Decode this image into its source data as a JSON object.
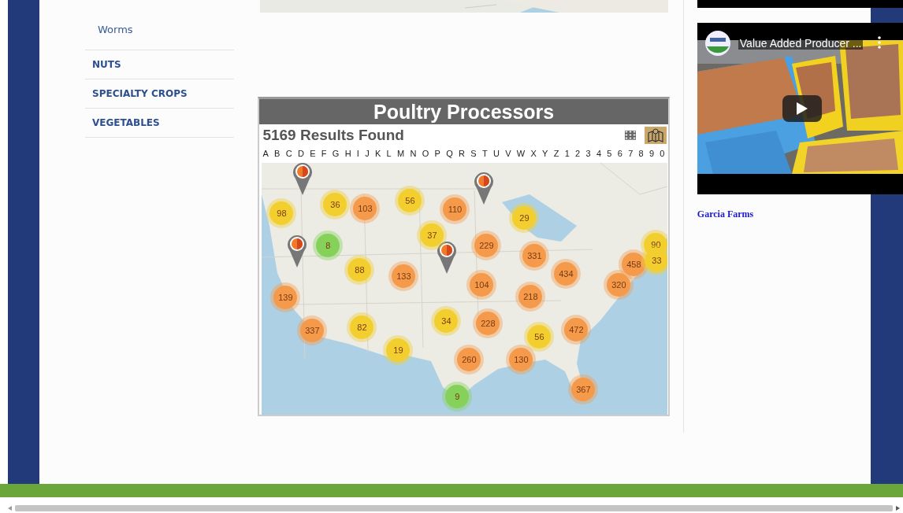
{
  "sidebar": {
    "items": [
      {
        "label": "Worms",
        "kind": "sub"
      },
      {
        "label": "NUTS",
        "kind": "category"
      },
      {
        "label": "SPECIALTY CROPS",
        "kind": "category"
      },
      {
        "label": "VEGETABLES",
        "kind": "category"
      }
    ]
  },
  "directory": {
    "title": "Poultry Processors",
    "results": "5169 Results Found",
    "views": [
      {
        "kind": "grid",
        "selected": false
      },
      {
        "kind": "map",
        "selected": true
      }
    ],
    "letters": [
      "A",
      "B",
      "C",
      "D",
      "E",
      "F",
      "G",
      "H",
      "I",
      "J",
      "K",
      "L",
      "M",
      "N",
      "O",
      "P",
      "Q",
      "R",
      "S",
      "T",
      "U",
      "V",
      "W",
      "X",
      "Y",
      "Z",
      "1",
      "2",
      "3",
      "4",
      "5",
      "6",
      "7",
      "8",
      "9",
      "0"
    ],
    "clusters": [
      {
        "count": "98",
        "color": "#f2cf2f"
      },
      {
        "count": "36",
        "color": "#f2cf2f"
      },
      {
        "count": "103",
        "color": "#f49a4a"
      },
      {
        "count": "56",
        "color": "#f2cf2f"
      },
      {
        "count": "110",
        "color": "#f49a4a"
      },
      {
        "count": "29",
        "color": "#f2cf2f"
      },
      {
        "count": "37",
        "color": "#f2cf2f"
      },
      {
        "count": "8",
        "color": "#86d15a"
      },
      {
        "count": "229",
        "color": "#f49a4a"
      },
      {
        "count": "331",
        "color": "#f49a4a"
      },
      {
        "count": "88",
        "color": "#f2cf2f"
      },
      {
        "count": "133",
        "color": "#f49a4a"
      },
      {
        "count": "104",
        "color": "#f49a4a"
      },
      {
        "count": "434",
        "color": "#f49a4a"
      },
      {
        "count": "458",
        "color": "#f49a4a"
      },
      {
        "count": "90",
        "color": "#f2cf2f"
      },
      {
        "count": "33",
        "color": "#f2cf2f"
      },
      {
        "count": "320",
        "color": "#f49a4a"
      },
      {
        "count": "139",
        "color": "#f49a4a"
      },
      {
        "count": "218",
        "color": "#f49a4a"
      },
      {
        "count": "337",
        "color": "#f49a4a"
      },
      {
        "count": "82",
        "color": "#f2cf2f"
      },
      {
        "count": "34",
        "color": "#f2cf2f"
      },
      {
        "count": "228",
        "color": "#f49a4a"
      },
      {
        "count": "472",
        "color": "#f49a4a"
      },
      {
        "count": "56",
        "color": "#f2cf2f"
      },
      {
        "count": "19",
        "color": "#f2cf2f"
      },
      {
        "count": "260",
        "color": "#f49a4a"
      },
      {
        "count": "130",
        "color": "#f49a4a"
      },
      {
        "count": "367",
        "color": "#f49a4a"
      },
      {
        "count": "9",
        "color": "#86d15a"
      }
    ]
  },
  "video": {
    "title": "Value Added Producer ..."
  },
  "links": [
    "Garcia Farms"
  ]
}
